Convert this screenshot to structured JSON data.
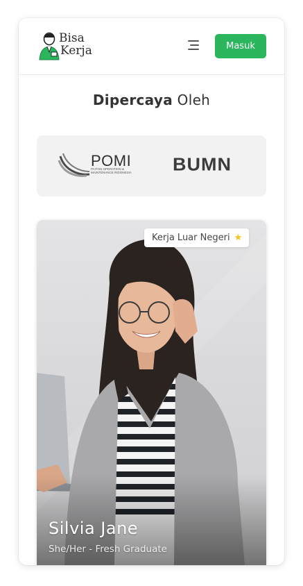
{
  "header": {
    "logo": {
      "line1": "Bisa",
      "line2": "Kerja"
    },
    "menu_icon": "hamburger-menu-icon",
    "login_label": "Masuk"
  },
  "trusted": {
    "title_bold": "Dipercaya",
    "title_rest": "Oleh"
  },
  "partners": [
    {
      "name": "POMI",
      "subtitle": "PAITON OPERATION & MAINTENANCE INDONESIA"
    },
    {
      "name": "BUMN"
    }
  ],
  "profile": {
    "badge": "Kerja Luar Negeri",
    "badge_icon": "star-icon",
    "name": "Silvia Jane",
    "role": "She/Her - Fresh Graduate"
  },
  "colors": {
    "accent": "#2bb55c",
    "star": "#f6c31b"
  }
}
